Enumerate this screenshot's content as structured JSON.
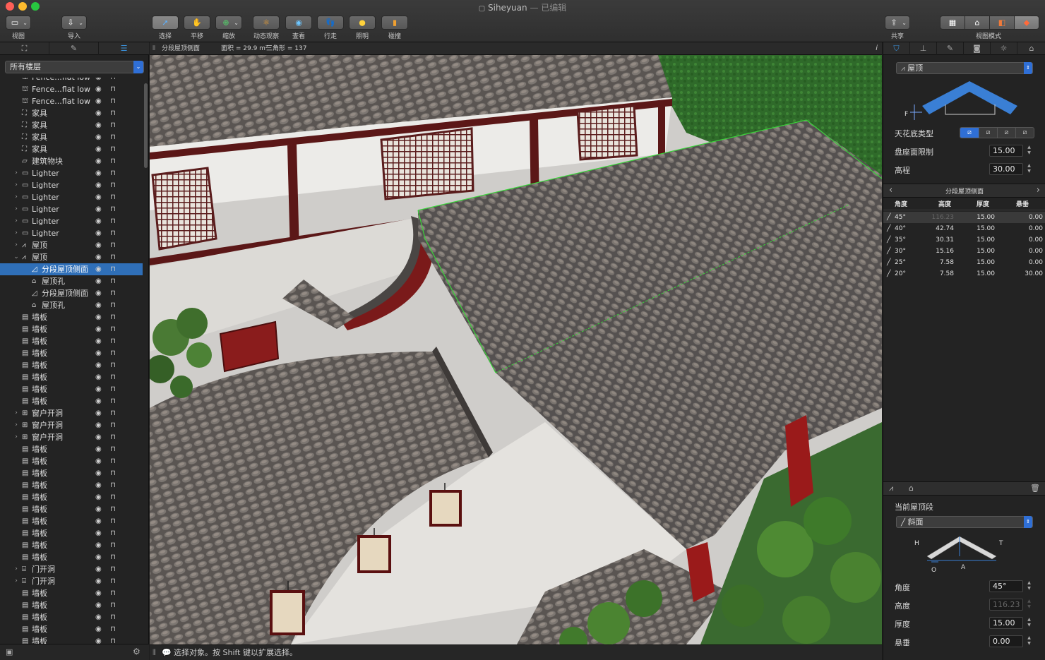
{
  "window": {
    "title": "Siheyuan",
    "subtitle": "— 已编辑"
  },
  "toolbar": {
    "view_label": "视图",
    "import_label": "导入",
    "select_label": "选择",
    "pan_label": "平移",
    "zoom_label": "缩放",
    "orbit_label": "动态观察",
    "look_label": "查看",
    "walk_label": "行走",
    "lighting_label": "照明",
    "collision_label": "碰撞",
    "share_label": "共享",
    "view_mode_label": "视图模式"
  },
  "colors": {
    "accent": "#2f6fd6",
    "selection": "#2f6fb8",
    "roof_blue": "#3a7fd5"
  },
  "left_panel": {
    "tabs": [
      "furniture-icon",
      "draw-icon",
      "list-icon"
    ],
    "floor_selector": "所有楼层",
    "tree": [
      {
        "label": "Fence...flat low",
        "icon": "fence-icon",
        "indent": 0,
        "expander": ""
      },
      {
        "label": "Fence...flat low",
        "icon": "fence-icon",
        "indent": 0,
        "expander": ""
      },
      {
        "label": "Fence...flat low",
        "icon": "fence-icon",
        "indent": 0,
        "expander": ""
      },
      {
        "label": "家具",
        "icon": "chair-icon",
        "indent": 0,
        "expander": ""
      },
      {
        "label": "家具",
        "icon": "chair-icon",
        "indent": 0,
        "expander": ""
      },
      {
        "label": "家具",
        "icon": "chair-icon",
        "indent": 0,
        "expander": ""
      },
      {
        "label": "家具",
        "icon": "chair-icon",
        "indent": 0,
        "expander": ""
      },
      {
        "label": "建筑物块",
        "icon": "block-icon",
        "indent": 0,
        "expander": ""
      },
      {
        "label": "Lighter",
        "icon": "folder-icon",
        "indent": 0,
        "expander": "›"
      },
      {
        "label": "Lighter",
        "icon": "folder-icon",
        "indent": 0,
        "expander": "›"
      },
      {
        "label": "Lighter",
        "icon": "folder-icon",
        "indent": 0,
        "expander": "›"
      },
      {
        "label": "Lighter",
        "icon": "folder-icon",
        "indent": 0,
        "expander": "›"
      },
      {
        "label": "Lighter",
        "icon": "folder-icon",
        "indent": 0,
        "expander": "›"
      },
      {
        "label": "Lighter",
        "icon": "folder-icon",
        "indent": 0,
        "expander": "›"
      },
      {
        "label": "屋顶",
        "icon": "roof-icon",
        "indent": 0,
        "expander": "›"
      },
      {
        "label": "屋顶",
        "icon": "roof-icon",
        "indent": 0,
        "expander": "⌄"
      },
      {
        "label": "分段屋顶侧面",
        "icon": "roof-side-icon",
        "indent": 1,
        "expander": "",
        "selected": true
      },
      {
        "label": "屋顶孔",
        "icon": "roof-hole-icon",
        "indent": 1,
        "expander": ""
      },
      {
        "label": "分段屋顶侧面",
        "icon": "roof-side-icon",
        "indent": 1,
        "expander": ""
      },
      {
        "label": "屋顶孔",
        "icon": "roof-hole-icon",
        "indent": 1,
        "expander": ""
      },
      {
        "label": "墙板",
        "icon": "panel-icon",
        "indent": 0,
        "expander": ""
      },
      {
        "label": "墙板",
        "icon": "panel-icon",
        "indent": 0,
        "expander": ""
      },
      {
        "label": "墙板",
        "icon": "panel-icon",
        "indent": 0,
        "expander": ""
      },
      {
        "label": "墙板",
        "icon": "panel-icon",
        "indent": 0,
        "expander": ""
      },
      {
        "label": "墙板",
        "icon": "panel-icon",
        "indent": 0,
        "expander": ""
      },
      {
        "label": "墙板",
        "icon": "panel-icon",
        "indent": 0,
        "expander": ""
      },
      {
        "label": "墙板",
        "icon": "panel-icon",
        "indent": 0,
        "expander": ""
      },
      {
        "label": "墙板",
        "icon": "panel-icon",
        "indent": 0,
        "expander": ""
      },
      {
        "label": "窗户开洞",
        "icon": "window-icon",
        "indent": 0,
        "expander": "›"
      },
      {
        "label": "窗户开洞",
        "icon": "window-icon",
        "indent": 0,
        "expander": "›"
      },
      {
        "label": "窗户开洞",
        "icon": "window-icon",
        "indent": 0,
        "expander": "›"
      },
      {
        "label": "墙板",
        "icon": "panel-icon",
        "indent": 0,
        "expander": ""
      },
      {
        "label": "墙板",
        "icon": "panel-icon",
        "indent": 0,
        "expander": ""
      },
      {
        "label": "墙板",
        "icon": "panel-icon",
        "indent": 0,
        "expander": ""
      },
      {
        "label": "墙板",
        "icon": "panel-icon",
        "indent": 0,
        "expander": ""
      },
      {
        "label": "墙板",
        "icon": "panel-icon",
        "indent": 0,
        "expander": ""
      },
      {
        "label": "墙板",
        "icon": "panel-icon",
        "indent": 0,
        "expander": ""
      },
      {
        "label": "墙板",
        "icon": "panel-icon",
        "indent": 0,
        "expander": ""
      },
      {
        "label": "墙板",
        "icon": "panel-icon",
        "indent": 0,
        "expander": ""
      },
      {
        "label": "墙板",
        "icon": "panel-icon",
        "indent": 0,
        "expander": ""
      },
      {
        "label": "墙板",
        "icon": "panel-icon",
        "indent": 0,
        "expander": ""
      },
      {
        "label": "门开洞",
        "icon": "door-icon",
        "indent": 0,
        "expander": "›"
      },
      {
        "label": "门开洞",
        "icon": "door-icon",
        "indent": 0,
        "expander": "›"
      },
      {
        "label": "墙板",
        "icon": "panel-icon",
        "indent": 0,
        "expander": ""
      },
      {
        "label": "墙板",
        "icon": "panel-icon",
        "indent": 0,
        "expander": ""
      },
      {
        "label": "墙板",
        "icon": "panel-icon",
        "indent": 0,
        "expander": ""
      },
      {
        "label": "墙板",
        "icon": "panel-icon",
        "indent": 0,
        "expander": ""
      },
      {
        "label": "墙板",
        "icon": "panel-icon",
        "indent": 0,
        "expander": ""
      }
    ]
  },
  "viewport": {
    "info_name": "分段屋顶侧面",
    "info_area": "面积 = 29.9 m²",
    "info_triangles": "三角形 = 137",
    "info_icon": "i"
  },
  "status": {
    "message": "选择对象。按 Shift 键以扩展选择。"
  },
  "right_panel": {
    "tabs": [
      "roof-settings-icon",
      "stamp-icon",
      "pencil-icon",
      "camera-icon",
      "sun-icon",
      "building-icon"
    ],
    "object_type": "屋顶",
    "diagram_label_f": "F",
    "ceiling_type_label": "天花底类型",
    "plate_limit_label": "盘座面限制",
    "plate_limit_value": "15.00",
    "height_label": "高程",
    "height_value": "30.00",
    "segment_nav_title": "分段屋顶侧面",
    "table": {
      "headers": [
        "角度",
        "高度",
        "厚度",
        "悬垂"
      ],
      "rows": [
        {
          "angle": "45°",
          "height": "116.23",
          "thickness": "15.00",
          "overhang": "0.00",
          "selected": true
        },
        {
          "angle": "40°",
          "height": "42.74",
          "thickness": "15.00",
          "overhang": "0.00"
        },
        {
          "angle": "35°",
          "height": "30.31",
          "thickness": "15.00",
          "overhang": "0.00"
        },
        {
          "angle": "30°",
          "height": "15.16",
          "thickness": "15.00",
          "overhang": "0.00"
        },
        {
          "angle": "25°",
          "height": "7.58",
          "thickness": "15.00",
          "overhang": "0.00"
        },
        {
          "angle": "20°",
          "height": "7.58",
          "thickness": "15.00",
          "overhang": "30.00"
        }
      ]
    },
    "current_segment_label": "当前屋顶段",
    "segment_type": "斜面",
    "diagram2": {
      "h": "H",
      "t": "T",
      "a": "A",
      "o": "O"
    },
    "angle_label": "角度",
    "angle_value": "45°",
    "seg_height_label": "高度",
    "seg_height_value": "116.23",
    "thickness_label": "厚度",
    "thickness_value": "15.00",
    "overhang_label": "悬垂",
    "overhang_value": "0.00"
  }
}
